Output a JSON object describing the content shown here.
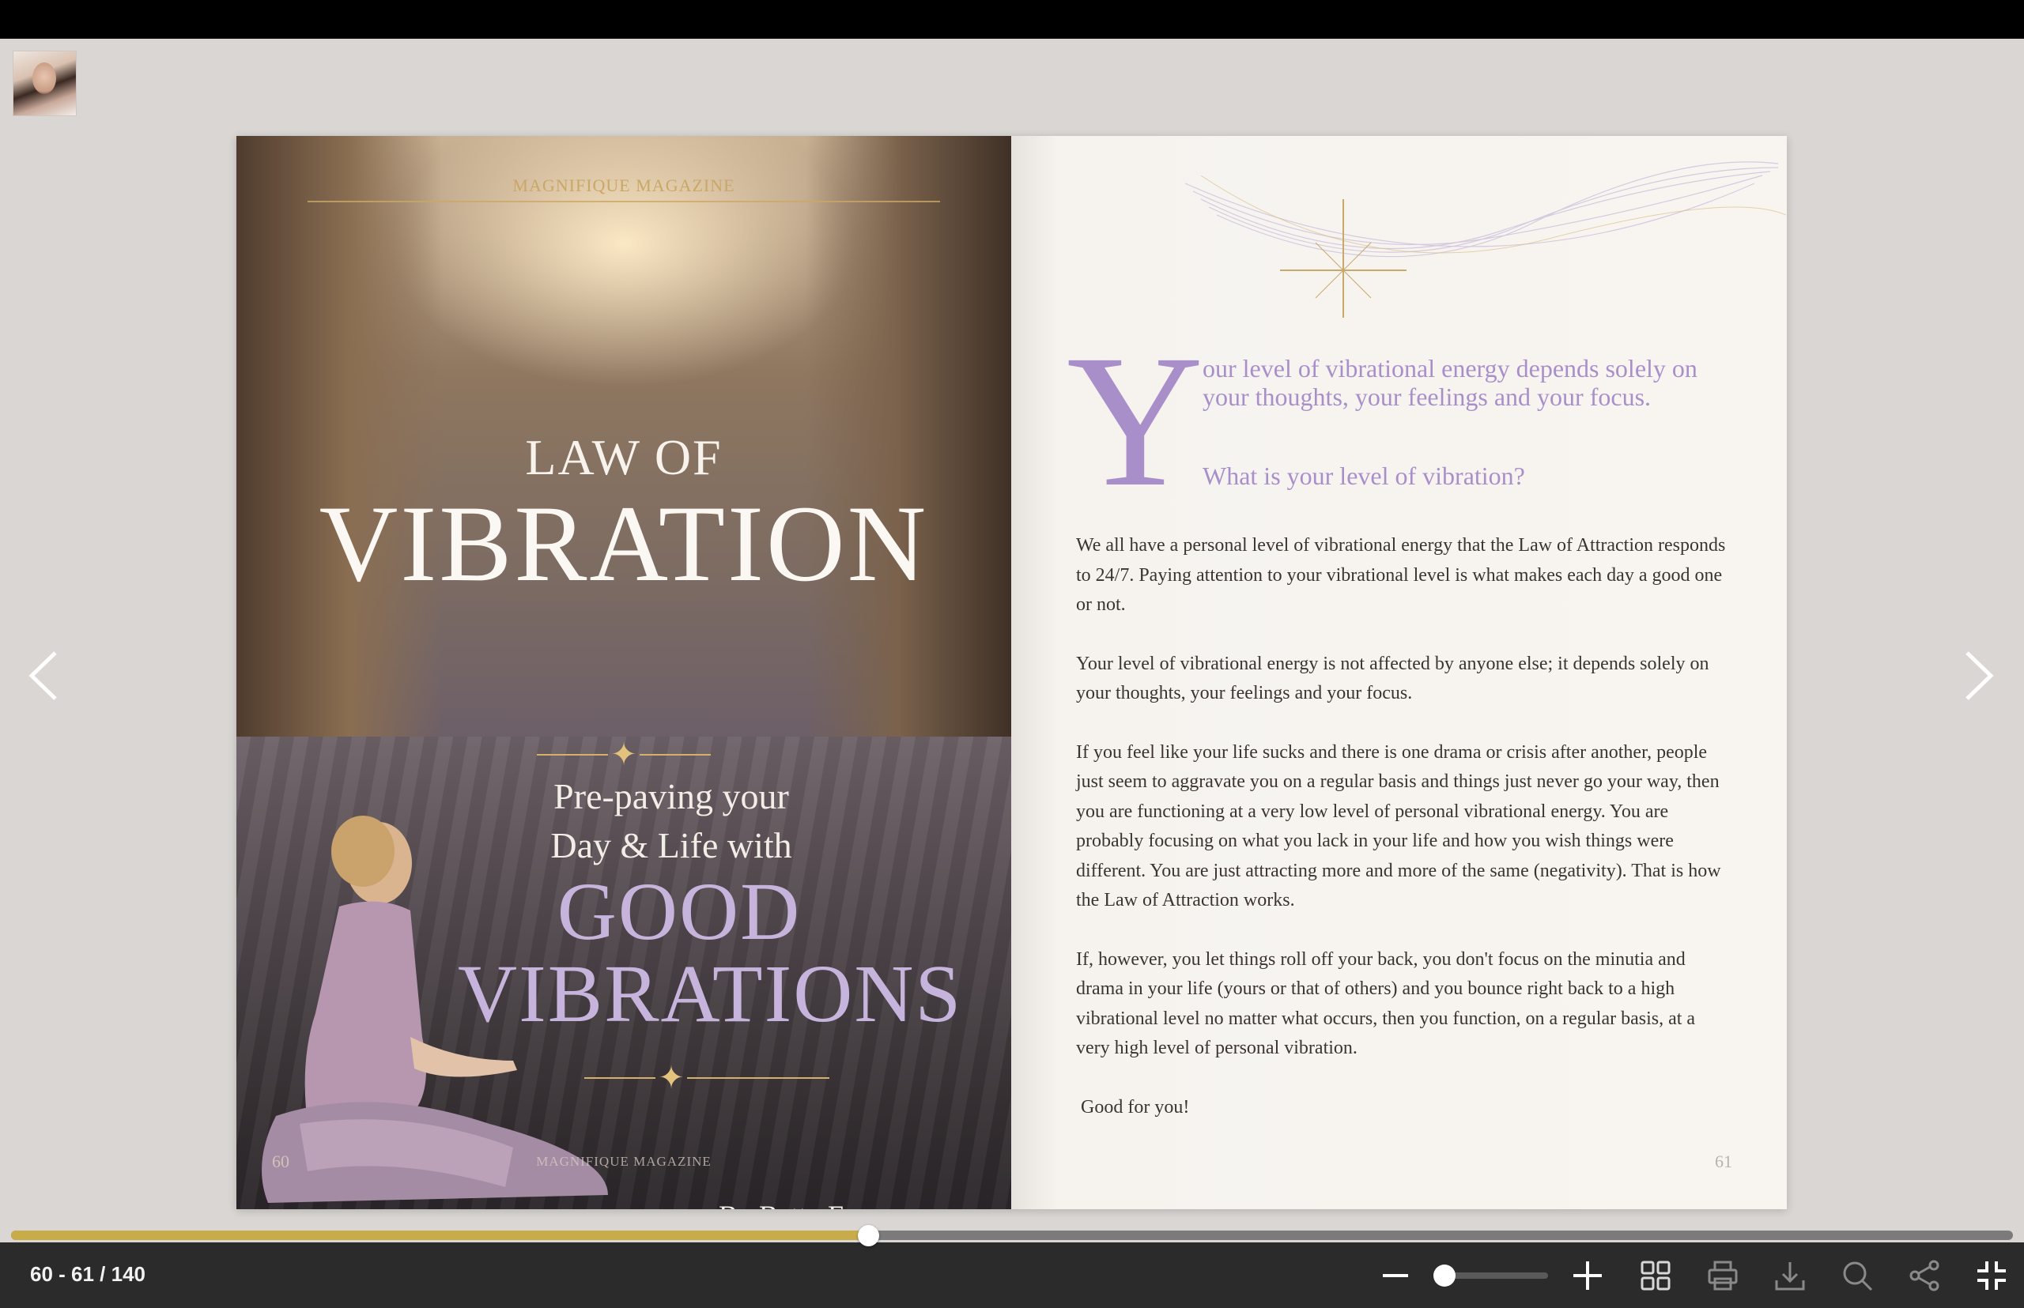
{
  "publisher": {
    "thumbnail_icon": "publisher-avatar"
  },
  "left_page": {
    "magazine_header": "MAGNIFIQUE MAGAZINE",
    "title_line1": "LAW OF",
    "title_line2": "VIBRATION",
    "subtitle_line1": "Pre-paving your",
    "subtitle_line2": "Day & Life with",
    "highlight_line1": "GOOD",
    "highlight_line2": "VIBRATIONS",
    "byline": "By Betty Ferguson",
    "page_number": "60",
    "footer": "MAGNIFIQUE MAGAZINE"
  },
  "right_page": {
    "drop_cap": "Y",
    "lead": "our level of vibrational energy depends solely on your thoughts, your feelings and your focus.",
    "lead_question": "What is your level of vibration?",
    "paragraphs": [
      "We all have a personal level of vibrational energy that the Law of Attraction responds to 24/7. Paying attention to your vibrational level is what makes each day a good one or not.",
      "Your level of vibrational energy is not affected by anyone else; it depends solely on your thoughts, your feelings and your focus.",
      "If you feel like your life sucks and there is one drama or crisis after another, people just seem to aggravate you on a regular basis and things just never go your way, then you are functioning at a very low level of personal vibrational energy. You are probably focusing on what you lack in your life and how you wish things were different. You are just attracting more and more of the same (negativity). That is how the Law of Attraction works.",
      "If, however, you let things roll off your back, you don't focus on the minutia and drama in your life (yours or that of others) and you bounce right back to a high vibrational level no matter what occurs, then you function, on a regular basis, at a very high level of personal vibration.",
      "Good for you!"
    ],
    "page_number": "61"
  },
  "navigation": {
    "prev_icon": "chevron-left-icon",
    "next_icon": "chevron-right-icon"
  },
  "toolbar": {
    "page_counter": "60 - 61 / 140",
    "progress": 0.429,
    "zoom_level": 0.05,
    "icons": [
      "zoom-out-icon",
      "zoom-in-icon",
      "thumbnails-grid-icon",
      "print-icon",
      "download-icon",
      "search-icon",
      "share-icon",
      "exit-fullscreen-icon"
    ]
  },
  "colors": {
    "accent_gold": "#c9ac4a",
    "lavender": "#a98fca",
    "toolbar_bg": "#2b2b2b"
  }
}
